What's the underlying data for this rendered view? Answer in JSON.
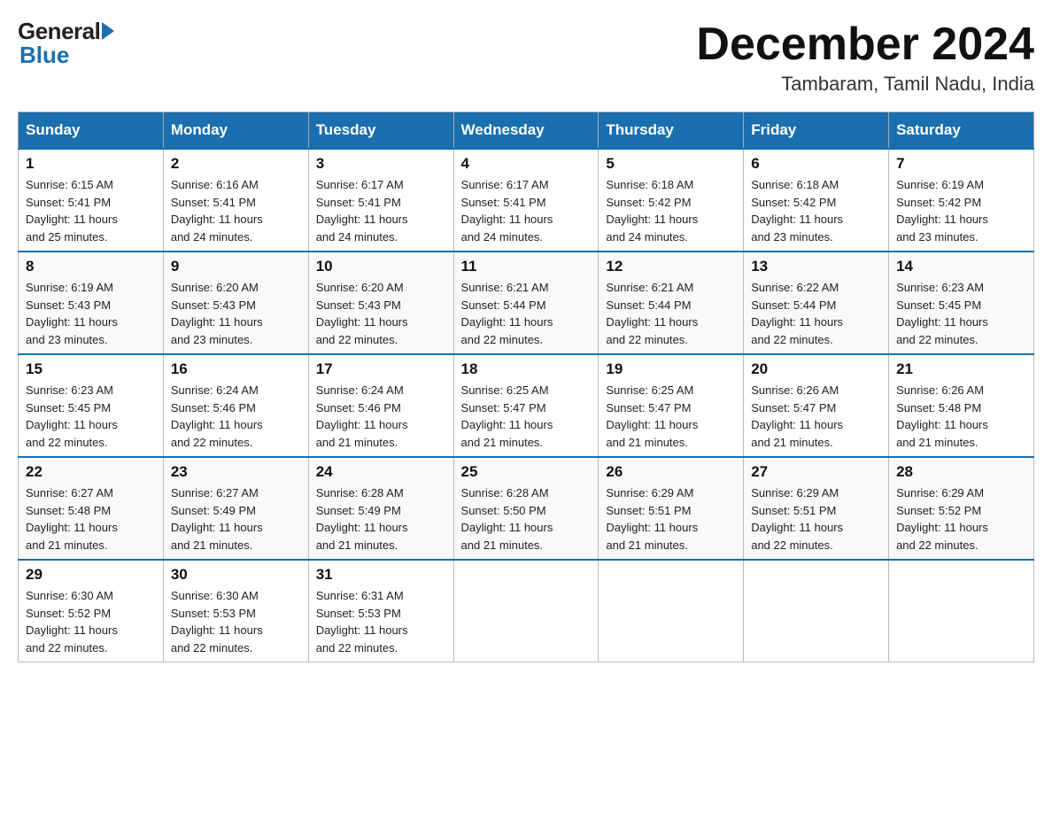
{
  "logo": {
    "general_text": "General",
    "blue_text": "Blue"
  },
  "title": {
    "month_year": "December 2024",
    "location": "Tambaram, Tamil Nadu, India"
  },
  "days_of_week": [
    "Sunday",
    "Monday",
    "Tuesday",
    "Wednesday",
    "Thursday",
    "Friday",
    "Saturday"
  ],
  "weeks": [
    [
      {
        "day": "1",
        "sunrise": "6:15 AM",
        "sunset": "5:41 PM",
        "daylight": "11 hours and 25 minutes."
      },
      {
        "day": "2",
        "sunrise": "6:16 AM",
        "sunset": "5:41 PM",
        "daylight": "11 hours and 24 minutes."
      },
      {
        "day": "3",
        "sunrise": "6:17 AM",
        "sunset": "5:41 PM",
        "daylight": "11 hours and 24 minutes."
      },
      {
        "day": "4",
        "sunrise": "6:17 AM",
        "sunset": "5:41 PM",
        "daylight": "11 hours and 24 minutes."
      },
      {
        "day": "5",
        "sunrise": "6:18 AM",
        "sunset": "5:42 PM",
        "daylight": "11 hours and 24 minutes."
      },
      {
        "day": "6",
        "sunrise": "6:18 AM",
        "sunset": "5:42 PM",
        "daylight": "11 hours and 23 minutes."
      },
      {
        "day": "7",
        "sunrise": "6:19 AM",
        "sunset": "5:42 PM",
        "daylight": "11 hours and 23 minutes."
      }
    ],
    [
      {
        "day": "8",
        "sunrise": "6:19 AM",
        "sunset": "5:43 PM",
        "daylight": "11 hours and 23 minutes."
      },
      {
        "day": "9",
        "sunrise": "6:20 AM",
        "sunset": "5:43 PM",
        "daylight": "11 hours and 23 minutes."
      },
      {
        "day": "10",
        "sunrise": "6:20 AM",
        "sunset": "5:43 PM",
        "daylight": "11 hours and 22 minutes."
      },
      {
        "day": "11",
        "sunrise": "6:21 AM",
        "sunset": "5:44 PM",
        "daylight": "11 hours and 22 minutes."
      },
      {
        "day": "12",
        "sunrise": "6:21 AM",
        "sunset": "5:44 PM",
        "daylight": "11 hours and 22 minutes."
      },
      {
        "day": "13",
        "sunrise": "6:22 AM",
        "sunset": "5:44 PM",
        "daylight": "11 hours and 22 minutes."
      },
      {
        "day": "14",
        "sunrise": "6:23 AM",
        "sunset": "5:45 PM",
        "daylight": "11 hours and 22 minutes."
      }
    ],
    [
      {
        "day": "15",
        "sunrise": "6:23 AM",
        "sunset": "5:45 PM",
        "daylight": "11 hours and 22 minutes."
      },
      {
        "day": "16",
        "sunrise": "6:24 AM",
        "sunset": "5:46 PM",
        "daylight": "11 hours and 22 minutes."
      },
      {
        "day": "17",
        "sunrise": "6:24 AM",
        "sunset": "5:46 PM",
        "daylight": "11 hours and 21 minutes."
      },
      {
        "day": "18",
        "sunrise": "6:25 AM",
        "sunset": "5:47 PM",
        "daylight": "11 hours and 21 minutes."
      },
      {
        "day": "19",
        "sunrise": "6:25 AM",
        "sunset": "5:47 PM",
        "daylight": "11 hours and 21 minutes."
      },
      {
        "day": "20",
        "sunrise": "6:26 AM",
        "sunset": "5:47 PM",
        "daylight": "11 hours and 21 minutes."
      },
      {
        "day": "21",
        "sunrise": "6:26 AM",
        "sunset": "5:48 PM",
        "daylight": "11 hours and 21 minutes."
      }
    ],
    [
      {
        "day": "22",
        "sunrise": "6:27 AM",
        "sunset": "5:48 PM",
        "daylight": "11 hours and 21 minutes."
      },
      {
        "day": "23",
        "sunrise": "6:27 AM",
        "sunset": "5:49 PM",
        "daylight": "11 hours and 21 minutes."
      },
      {
        "day": "24",
        "sunrise": "6:28 AM",
        "sunset": "5:49 PM",
        "daylight": "11 hours and 21 minutes."
      },
      {
        "day": "25",
        "sunrise": "6:28 AM",
        "sunset": "5:50 PM",
        "daylight": "11 hours and 21 minutes."
      },
      {
        "day": "26",
        "sunrise": "6:29 AM",
        "sunset": "5:51 PM",
        "daylight": "11 hours and 21 minutes."
      },
      {
        "day": "27",
        "sunrise": "6:29 AM",
        "sunset": "5:51 PM",
        "daylight": "11 hours and 22 minutes."
      },
      {
        "day": "28",
        "sunrise": "6:29 AM",
        "sunset": "5:52 PM",
        "daylight": "11 hours and 22 minutes."
      }
    ],
    [
      {
        "day": "29",
        "sunrise": "6:30 AM",
        "sunset": "5:52 PM",
        "daylight": "11 hours and 22 minutes."
      },
      {
        "day": "30",
        "sunrise": "6:30 AM",
        "sunset": "5:53 PM",
        "daylight": "11 hours and 22 minutes."
      },
      {
        "day": "31",
        "sunrise": "6:31 AM",
        "sunset": "5:53 PM",
        "daylight": "11 hours and 22 minutes."
      },
      null,
      null,
      null,
      null
    ]
  ],
  "labels": {
    "sunrise": "Sunrise:",
    "sunset": "Sunset:",
    "daylight": "Daylight:"
  }
}
